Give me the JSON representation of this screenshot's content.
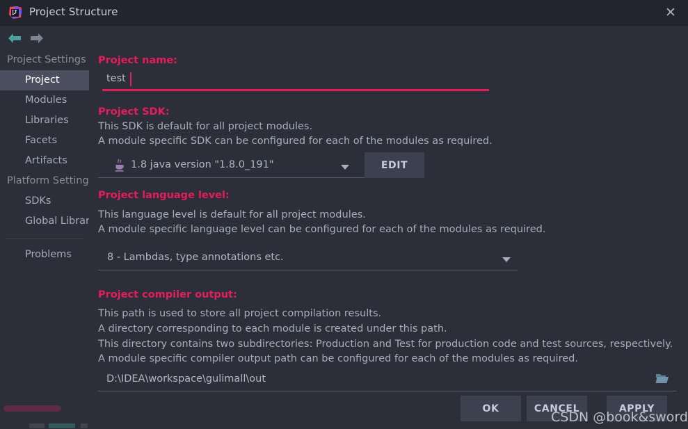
{
  "window": {
    "title": "Project Structure",
    "logo_icon": "intellij-idea-logo",
    "close_icon": "close-icon"
  },
  "nav": {
    "back_icon": "arrow-left-icon",
    "forward_icon": "arrow-right-icon"
  },
  "sidebar": {
    "groups": [
      {
        "label": "Project Settings",
        "items": [
          {
            "label": "Project",
            "selected": true
          },
          {
            "label": "Modules",
            "selected": false
          },
          {
            "label": "Libraries",
            "selected": false
          },
          {
            "label": "Facets",
            "selected": false
          },
          {
            "label": "Artifacts",
            "selected": false
          }
        ]
      },
      {
        "label": "Platform Settings",
        "items": [
          {
            "label": "SDKs",
            "selected": false
          },
          {
            "label": "Global Libraries",
            "selected": false
          }
        ]
      }
    ],
    "problems_label": "Problems"
  },
  "main": {
    "project_name": {
      "label": "Project name:",
      "value": "test"
    },
    "project_sdk": {
      "label": "Project SDK:",
      "desc_line1": "This SDK is default for all project modules.",
      "desc_line2": "A module specific SDK can be configured for each of the modules as required.",
      "selected": "1.8 java version \"1.8.0_191\"",
      "sdk_icon": "java-icon",
      "dropdown_icon": "chevron-down-icon",
      "edit_label": "EDIT"
    },
    "language_level": {
      "label": "Project language level:",
      "desc_line1": "This language level is default for all project modules.",
      "desc_line2": "A module specific language level can be configured for each of the modules as required.",
      "selected": "8 - Lambdas, type annotations etc.",
      "dropdown_icon": "chevron-down-icon"
    },
    "compiler_output": {
      "label": "Project compiler output:",
      "desc_line1": "This path is used to store all project compilation results.",
      "desc_line2": "A directory corresponding to each module is created under this path.",
      "desc_line3": "This directory contains two subdirectories: Production and Test for production code and test sources, respectively.",
      "desc_line4": "A module specific compiler output path can be configured for each of the modules as required.",
      "value": "D:\\IDEA\\workspace\\gulimall\\out",
      "browse_icon": "folder-icon"
    }
  },
  "footer": {
    "ok_label": "OK",
    "cancel_label": "CANCEL",
    "apply_label": "APPLY"
  },
  "watermark": {
    "text": "CSDN @book&sword"
  },
  "colors": {
    "accent": "#e31e5b",
    "background": "#2c2f3a",
    "titlebar": "#23252e",
    "selection": "#4b4f5f",
    "text": "#a7aebc",
    "button": "#3c4150",
    "scroll_thumb": "#5c2b45"
  }
}
